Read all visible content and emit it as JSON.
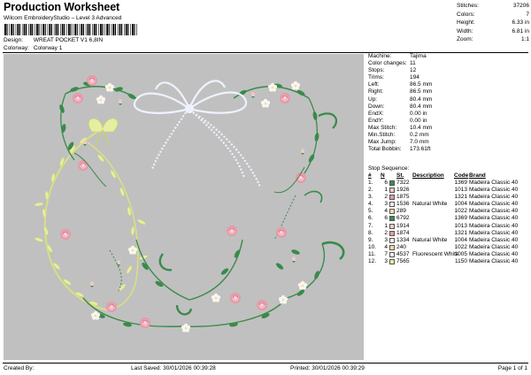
{
  "header": {
    "title": "Production Worksheet",
    "subtitle": "Wilcom EmbroideryStudio – Level 3 Advanced",
    "design_label": "Design:",
    "design_value": "WREAT POCKET V1 6,8IN",
    "colorway_label": "Colorway:",
    "colorway_value": "Colorway 1"
  },
  "stats_top": [
    {
      "k": "Stitches:",
      "v": "37206"
    },
    {
      "k": "Colors:",
      "v": "7"
    },
    {
      "k": "Height:",
      "v": "6.33 in"
    },
    {
      "k": "Width:",
      "v": "6.81 in"
    },
    {
      "k": "Zoom:",
      "v": "1:1"
    }
  ],
  "info": [
    {
      "k": "Machine:",
      "v": "Tajima"
    },
    {
      "k": "Color changes:",
      "v": "11"
    },
    {
      "k": "Stops:",
      "v": "12"
    },
    {
      "k": "Trims:",
      "v": "194"
    },
    {
      "k": "Left:",
      "v": "86.5 mm"
    },
    {
      "k": "Right:",
      "v": "86.5 mm"
    },
    {
      "k": "Up:",
      "v": "80.4 mm"
    },
    {
      "k": "Down:",
      "v": "80.4 mm"
    },
    {
      "k": "EndX:",
      "v": "0.00 in"
    },
    {
      "k": "EndY:",
      "v": "0.00 in"
    },
    {
      "k": "Max Stitch:",
      "v": "10.4 mm"
    },
    {
      "k": "Min.Stitch:",
      "v": "0.2 mm"
    },
    {
      "k": "Max Jump:",
      "v": "7.0 mm"
    },
    {
      "k": "Total Bobbin:",
      "v": "173.61ft"
    }
  ],
  "sequence": {
    "title": "Stop Sequence:",
    "headers": {
      "n": "#",
      "n2": "N",
      "st": "St.",
      "desc": "Description",
      "code": "Code",
      "brand": "Brand"
    },
    "rows": [
      {
        "n": "1.",
        "s": "6",
        "color": "#3a8a4a",
        "st": "7322",
        "desc": "",
        "code": "1369",
        "brand": "Madeira Classic 40"
      },
      {
        "n": "2.",
        "s": "1",
        "color": "#f0c8c8",
        "st": "1926",
        "desc": "",
        "code": "1013",
        "brand": "Madeira Classic 40"
      },
      {
        "n": "3.",
        "s": "2",
        "color": "#e898a8",
        "st": "1875",
        "desc": "",
        "code": "1321",
        "brand": "Madeira Classic 40"
      },
      {
        "n": "4.",
        "s": "3",
        "color": "#f8f6ee",
        "st": "1536",
        "desc": "Natural White",
        "code": "1004",
        "brand": "Madeira Classic 40"
      },
      {
        "n": "5.",
        "s": "4",
        "color": "#f4dca0",
        "st": "289",
        "desc": "",
        "code": "1022",
        "brand": "Madeira Classic 40"
      },
      {
        "n": "6.",
        "s": "6",
        "color": "#3a8a4a",
        "st": "6792",
        "desc": "",
        "code": "1369",
        "brand": "Madeira Classic 40"
      },
      {
        "n": "7.",
        "s": "1",
        "color": "#f0c8c8",
        "st": "1914",
        "desc": "",
        "code": "1013",
        "brand": "Madeira Classic 40"
      },
      {
        "n": "8.",
        "s": "2",
        "color": "#e898a8",
        "st": "1874",
        "desc": "",
        "code": "1321",
        "brand": "Madeira Classic 40"
      },
      {
        "n": "9.",
        "s": "3",
        "color": "#f8f6ee",
        "st": "1334",
        "desc": "Natural White",
        "code": "1004",
        "brand": "Madeira Classic 40"
      },
      {
        "n": "10.",
        "s": "4",
        "color": "#f4dca0",
        "st": "240",
        "desc": "",
        "code": "1022",
        "brand": "Madeira Classic 40"
      },
      {
        "n": "11.",
        "s": "7",
        "color": "#eef2ff",
        "st": "4537",
        "desc": "Fluorescent White",
        "code": "1005",
        "brand": "Madeira Classic 40"
      },
      {
        "n": "12.",
        "s": "3",
        "color": "#e6eea0",
        "st": "7565",
        "desc": "",
        "code": "1150",
        "brand": "Madeira Classic 40"
      }
    ]
  },
  "footer": {
    "created_by": "Created By:",
    "last_saved": "Last Saved: 30/01/2026 00:39:28",
    "printed": "Printed: 30/01/2026 00:39:29",
    "page": "Page 1 of 1"
  },
  "colors": {
    "canvas": "#c0c0c0",
    "leaf_green": "#3a8a4a",
    "pink": "#e898a8",
    "light_pink": "#f0c8c8",
    "yellow_green": "#e6eea0",
    "bow_white": "#eef2ff"
  }
}
